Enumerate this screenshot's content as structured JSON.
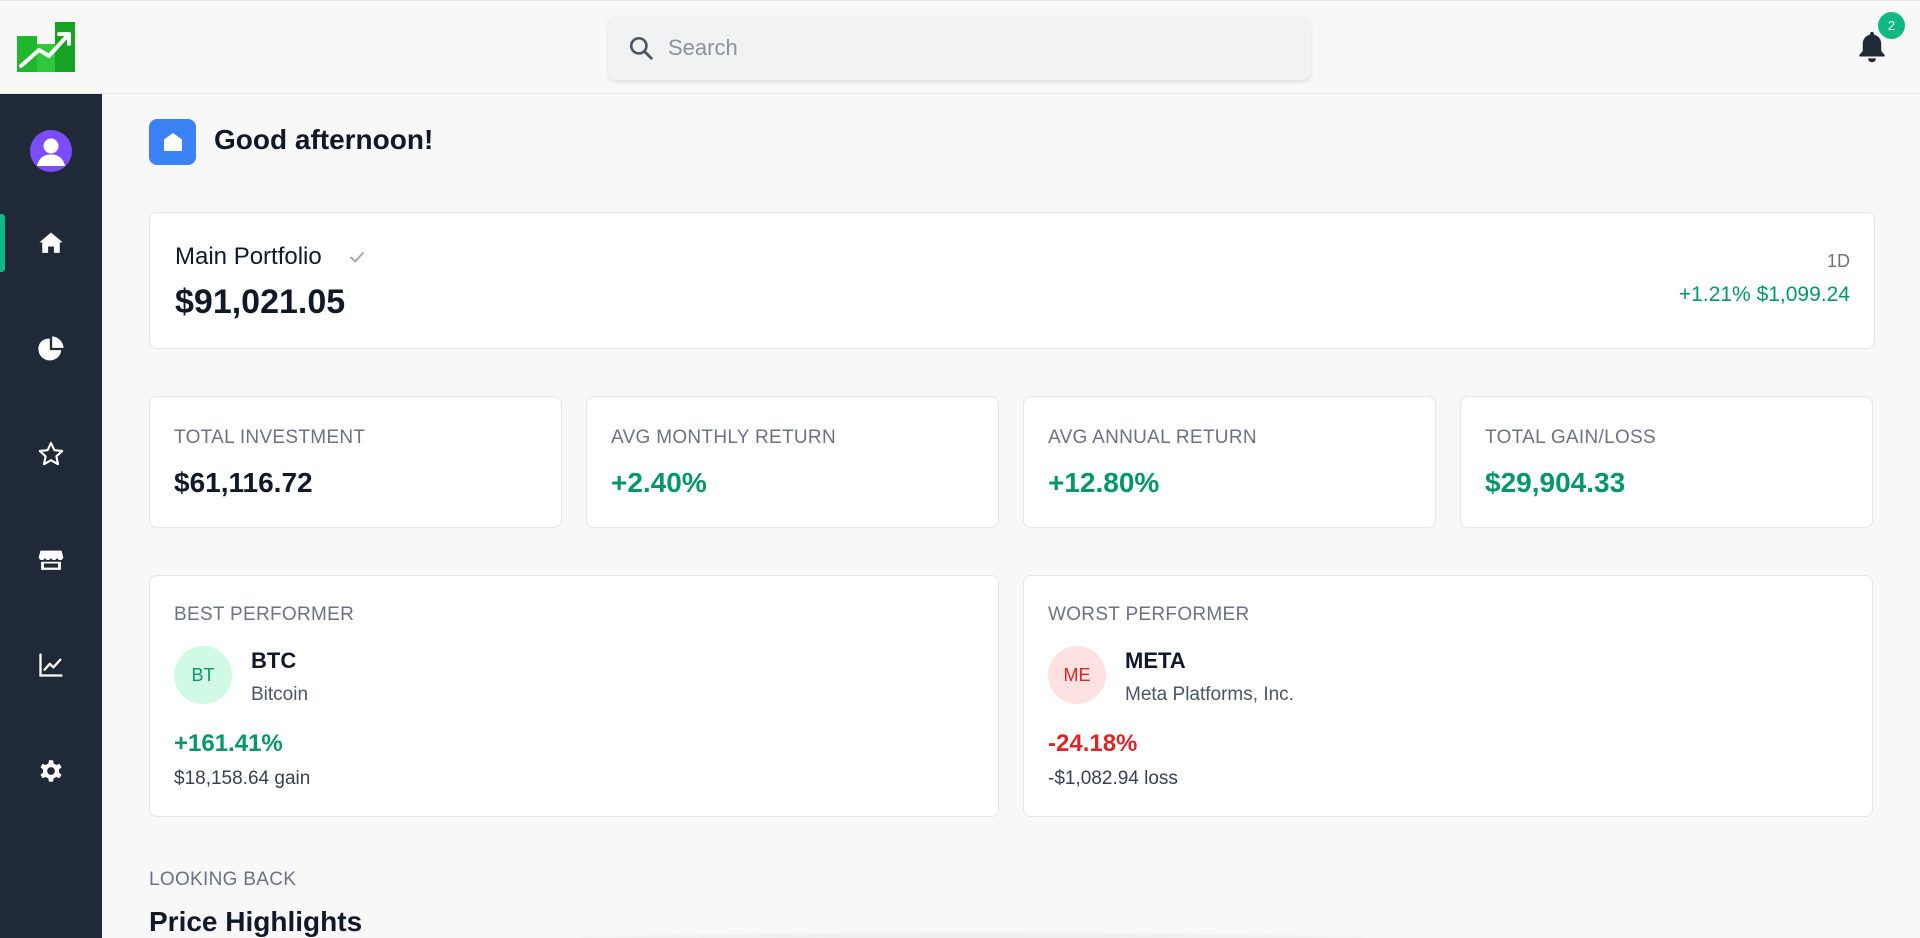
{
  "header": {
    "logo_icon": "chart-growth-logo-icon",
    "search": {
      "placeholder": "Search",
      "value": ""
    },
    "notifications": {
      "icon": "bell-icon",
      "count": "2"
    }
  },
  "sidebar": {
    "avatar_icon": "user-avatar-icon",
    "items": [
      {
        "id": "home",
        "icon": "home-icon",
        "active": true
      },
      {
        "id": "portfolio",
        "icon": "pie-chart-icon",
        "active": false
      },
      {
        "id": "watchlist",
        "icon": "star-icon",
        "active": false
      },
      {
        "id": "store",
        "icon": "store-icon",
        "active": false
      },
      {
        "id": "analytics",
        "icon": "line-chart-icon",
        "active": false
      },
      {
        "id": "settings",
        "icon": "gear-icon",
        "active": false
      }
    ]
  },
  "greeting": {
    "icon": "home-icon",
    "text": "Good afternoon!"
  },
  "portfolio": {
    "name": "Main Portfolio",
    "value": "$91,021.05",
    "period": "1D",
    "change": "+1.21% $1,099.24"
  },
  "stats": [
    {
      "label": "TOTAL INVESTMENT",
      "value": "$61,116.72",
      "tone": "dark"
    },
    {
      "label": "AVG MONTHLY RETURN",
      "value": "+2.40%",
      "tone": "green"
    },
    {
      "label": "AVG ANNUAL RETURN",
      "value": "+12.80%",
      "tone": "green"
    },
    {
      "label": "TOTAL GAIN/LOSS",
      "value": "$29,904.33",
      "tone": "green"
    }
  ],
  "best": {
    "label": "BEST PERFORMER",
    "badge": "BT",
    "symbol": "BTC",
    "name": "Bitcoin",
    "pct": "+161.41%",
    "sub": "$18,158.64 gain"
  },
  "worst": {
    "label": "WORST PERFORMER",
    "badge": "ME",
    "symbol": "META",
    "name": "Meta Platforms, Inc.",
    "pct": "-24.18%",
    "sub": "-$1,082.94 loss"
  },
  "section": {
    "eyebrow": "LOOKING BACK",
    "title": "Price Highlights"
  },
  "colors": {
    "accent_green": "#10b981",
    "gain_green": "#059669",
    "loss_red": "#dc2626",
    "sidebar_bg": "#1f2937",
    "greeting_blue": "#3b82f6"
  }
}
